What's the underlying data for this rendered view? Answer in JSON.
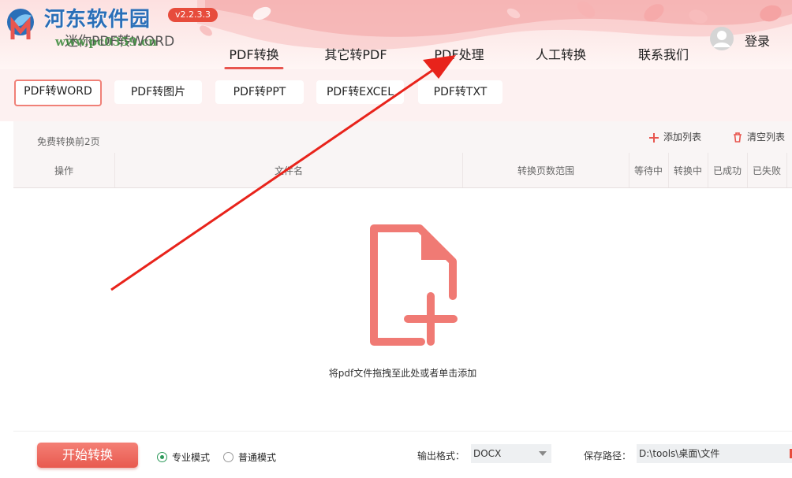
{
  "header": {
    "watermark_title": "河东软件园",
    "app_title": "迷你PDF转WORD",
    "watermark_url": "www.pc0359.cn",
    "version": "v2.2.3.3",
    "login_label": "登录"
  },
  "nav": {
    "items": [
      {
        "label": "PDF转换",
        "active": true
      },
      {
        "label": "其它转PDF",
        "active": false
      },
      {
        "label": "PDF处理",
        "active": false
      },
      {
        "label": "人工转换",
        "active": false
      },
      {
        "label": "联系我们",
        "active": false
      }
    ]
  },
  "subtabs": {
    "items": [
      {
        "label": "PDF转WORD",
        "active": true
      },
      {
        "label": "PDF转图片",
        "active": false
      },
      {
        "label": "PDF转PPT",
        "active": false
      },
      {
        "label": "PDF转EXCEL",
        "active": false
      },
      {
        "label": "PDF转TXT",
        "active": false
      }
    ]
  },
  "panel": {
    "free_note": "免费转换前2页",
    "add_list": "添加列表",
    "clear_list": "清空列表",
    "columns": [
      "操作",
      "文件名",
      "转换页数范围",
      "等待中",
      "转换中",
      "已成功",
      "已失败"
    ],
    "drop_hint": "将pdf文件拖拽至此处或者单击添加"
  },
  "bottom": {
    "start_label": "开始转换",
    "mode_pro": "专业模式",
    "mode_normal": "普通模式",
    "selected_mode": "专业模式",
    "output_format_label": "输出格式：",
    "output_format_value": "DOCX",
    "save_path_label": "保存路径：",
    "save_path_value": "D:\\tools\\桌面\\文件"
  },
  "colors": {
    "accent": "#e8564f",
    "header_bg": "#fde0e0",
    "subtab_bg": "#fdf1f1",
    "annotation_arrow": "#e8231b",
    "radio_selected": "#2e9a5b"
  },
  "icons": {
    "logo": "app-logo-icon",
    "avatar": "user-avatar-icon",
    "add": "plus-icon",
    "clear": "trash-icon",
    "drop": "add-file-icon",
    "dropdown": "chevron-down-icon"
  }
}
